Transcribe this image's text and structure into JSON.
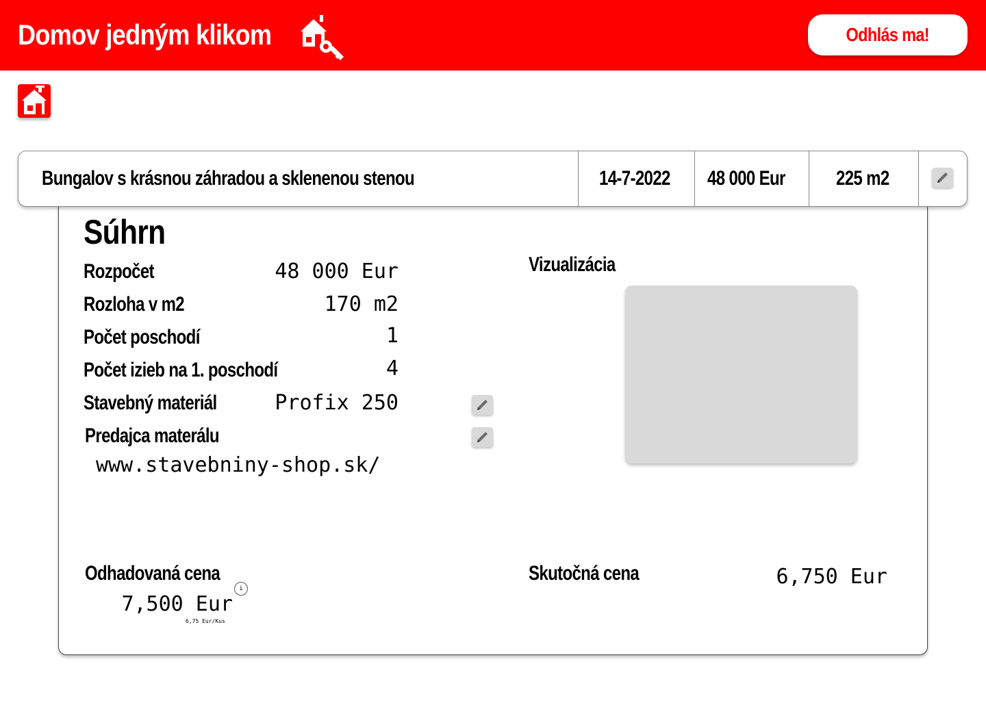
{
  "header": {
    "app_title": "Domov jedným klikom",
    "logout_label": "Odhlás ma!",
    "brand_color": "#ff0000"
  },
  "icons": {
    "logo": "house-key-icon",
    "home": "home-icon",
    "edit": "pencil-icon",
    "info": "info-icon"
  },
  "project": {
    "name": "Bungalov s krásnou záhradou a sklenenou stenou",
    "date": "14-7-2022",
    "price": "48 000 Eur",
    "area": "225 m2"
  },
  "summary": {
    "title": "Súhrn",
    "rows": [
      {
        "label": "Rozpočet",
        "value": "48 000 Eur"
      },
      {
        "label": "Rozloha v m2",
        "value": "170 m2"
      },
      {
        "label": "Počet poschodí",
        "value": "1"
      },
      {
        "label": "Počet izieb na 1. poschodí",
        "value": "4"
      },
      {
        "label": "Stavebný materiál",
        "value": "Profix 250"
      }
    ],
    "seller_label": "Predajca materálu",
    "seller_url": "www.stavebniny-shop.sk/",
    "visualization_label": "Vizualizácia",
    "estimated_price_label": "Odhadovaná cena",
    "estimated_price_value": "7,500 Eur",
    "estimated_info_icon_glyph": "i",
    "estimated_unit_note": "6,75 Eur/Kus",
    "actual_price_label": "Skutočná cena",
    "actual_price_value": "6,750 Eur"
  }
}
